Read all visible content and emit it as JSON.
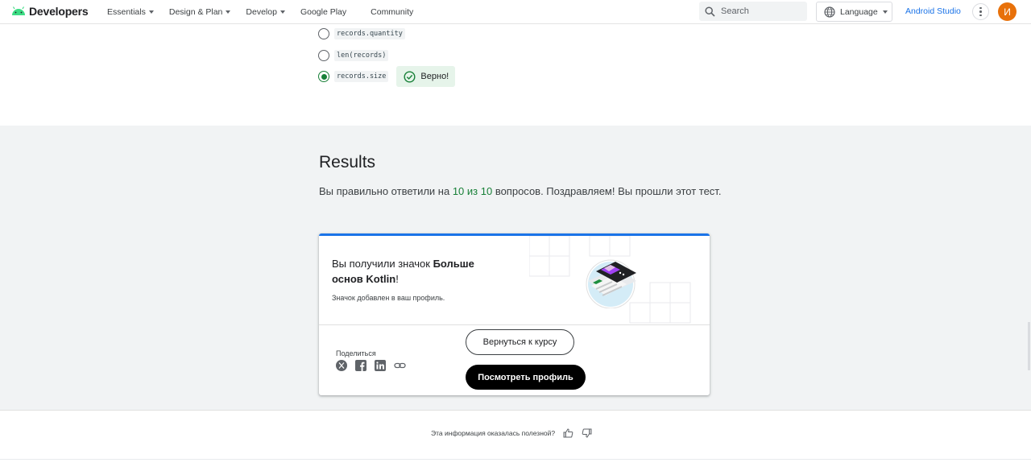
{
  "header": {
    "logo_text": "Developers",
    "nav": [
      {
        "label": "Essentials",
        "dropdown": true
      },
      {
        "label": "Design & Plan",
        "dropdown": true
      },
      {
        "label": "Develop",
        "dropdown": true
      },
      {
        "label": "Google Play",
        "dropdown": false
      },
      {
        "label": "Community",
        "dropdown": false
      }
    ],
    "search_placeholder": "Search",
    "language_label": "Language",
    "studio_link": "Android Studio",
    "avatar_initial": "И"
  },
  "quiz": {
    "options": [
      {
        "code": "records.quantity",
        "selected": false
      },
      {
        "code": "len(records)",
        "selected": false
      },
      {
        "code": "records.size",
        "selected": true
      }
    ],
    "correct_label": "Верно!"
  },
  "results": {
    "title": "Results",
    "text_before": "Вы правильно ответили на ",
    "score": "10 из 10",
    "text_after": " вопросов. Поздравляем! Вы прошли этот тест."
  },
  "badge_card": {
    "text_prefix": "Вы получили значок ",
    "badge_name": "Больше основ Kotlin",
    "text_suffix": "!",
    "subtext": "Значок добавлен в ваш профиль.",
    "share_label": "Поделиться",
    "share_icons": [
      "x-icon",
      "facebook-icon",
      "linkedin-icon",
      "link-icon"
    ],
    "back_button": "Вернуться к курсу",
    "profile_button": "Посмотреть профиль"
  },
  "feedback": {
    "question": "Эта информация оказалась полезной?"
  },
  "colors": {
    "accent": "#1a73e8",
    "success": "#188038",
    "success_bg": "#e6f4ea",
    "avatar": "#e8710a"
  }
}
